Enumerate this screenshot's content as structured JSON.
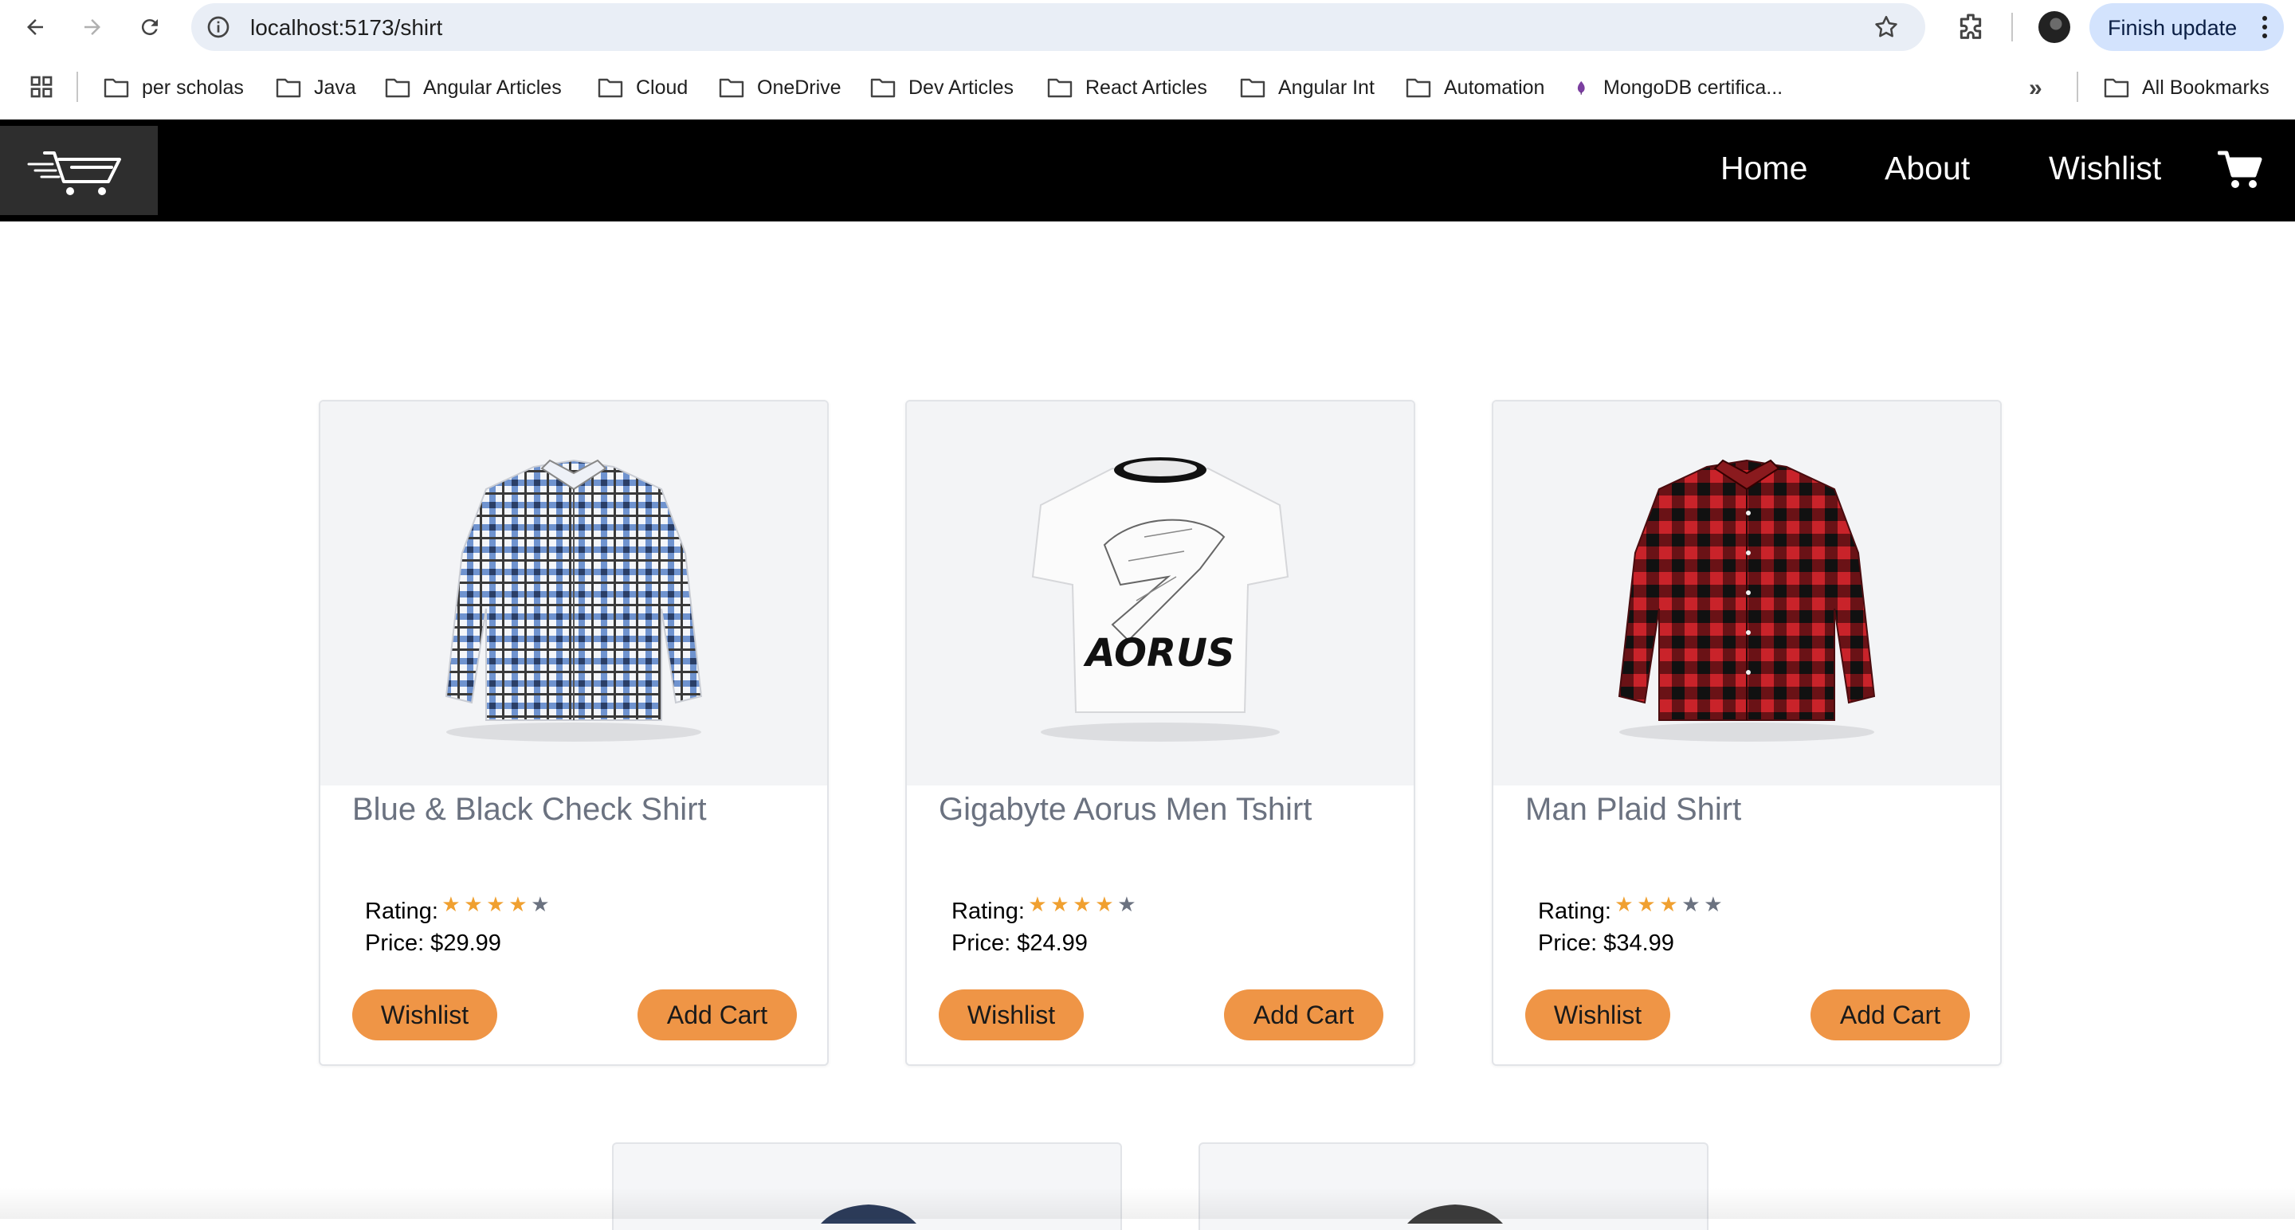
{
  "browser": {
    "url": "localhost:5173/shirt",
    "finish_update_label": "Finish update"
  },
  "bookmarks": {
    "items": [
      {
        "label": "per scholas",
        "icon": "folder-icon"
      },
      {
        "label": "Java",
        "icon": "folder-icon"
      },
      {
        "label": "Angular Articles",
        "icon": "folder-icon"
      },
      {
        "label": "Cloud",
        "icon": "folder-icon"
      },
      {
        "label": "OneDrive",
        "icon": "folder-icon"
      },
      {
        "label": "Dev Articles",
        "icon": "folder-icon"
      },
      {
        "label": "React Articles",
        "icon": "folder-icon"
      },
      {
        "label": "Angular Int",
        "icon": "folder-icon"
      },
      {
        "label": "Automation",
        "icon": "folder-icon"
      },
      {
        "label": "MongoDB certifica...",
        "icon": "mongodb-leaf-icon"
      }
    ],
    "overflow_label": "»",
    "all_bookmarks_label": "All Bookmarks"
  },
  "navbar": {
    "links": [
      "Home",
      "About",
      "Wishlist"
    ],
    "cart_icon": "shopping-cart-icon"
  },
  "products": [
    {
      "title": "Blue & Black Check Shirt",
      "rating_label": "Rating:",
      "rating": 4,
      "max_rating": 5,
      "price_label": "Price: $29.99",
      "wishlist_label": "Wishlist",
      "add_cart_label": "Add Cart",
      "image": "blue-check-shirt"
    },
    {
      "title": "Gigabyte Aorus Men Tshirt",
      "rating_label": "Rating:",
      "rating": 4,
      "max_rating": 5,
      "price_label": "Price: $24.99",
      "wishlist_label": "Wishlist",
      "add_cart_label": "Add Cart",
      "image": "aorus-tshirt",
      "print_text": "AORUS"
    },
    {
      "title": "Man Plaid Shirt",
      "rating_label": "Rating:",
      "rating": 3,
      "max_rating": 5,
      "price_label": "Price: $34.99",
      "wishlist_label": "Wishlist",
      "add_cart_label": "Add Cart",
      "image": "red-plaid-shirt"
    }
  ],
  "colors": {
    "accent_button": "#ef9546",
    "star_filled": "#f0a030",
    "star_empty": "#6b7280",
    "navbar_bg": "#000000"
  }
}
